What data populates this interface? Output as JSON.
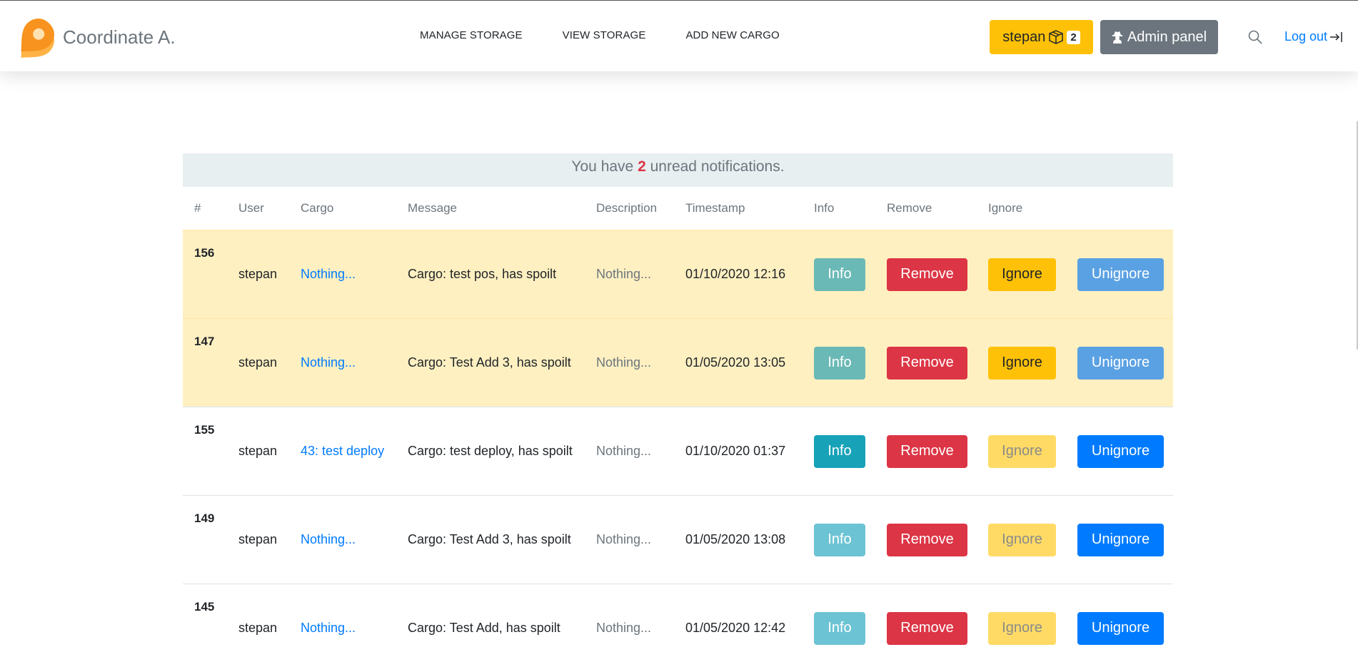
{
  "brand": {
    "name": "Coordinate A.",
    "logo": "map-pin-logo"
  },
  "nav": {
    "links": [
      "MANAGE STORAGE",
      "VIEW STORAGE",
      "ADD NEW CARGO"
    ],
    "user_button": {
      "label": "stepan",
      "icon": "box-icon",
      "badge": "2"
    },
    "admin_button": {
      "label": "Admin panel",
      "icon": "user-secret-icon"
    },
    "search_icon": "search-icon",
    "logout": {
      "label": "Log out",
      "icon": "sign-out-icon"
    }
  },
  "notifications": {
    "prefix": "You have ",
    "count": "2",
    "suffix": " unread notifications.",
    "columns": [
      "#",
      "User",
      "Cargo",
      "Message",
      "Description",
      "Timestamp",
      "Info",
      "Remove",
      "Ignore",
      ""
    ],
    "buttons": {
      "info": "Info",
      "remove": "Remove",
      "ignore": "Ignore",
      "unignore": "Unignore"
    },
    "rows": [
      {
        "id": "156",
        "user": "stepan",
        "cargo": "Nothing...",
        "message": "Cargo: test pos, has spoilt",
        "description": "Nothing...",
        "timestamp": "01/10/2020 12:16",
        "unread": true
      },
      {
        "id": "147",
        "user": "stepan",
        "cargo": "Nothing...",
        "message": "Cargo: Test Add 3, has spoilt",
        "description": "Nothing...",
        "timestamp": "01/05/2020 13:05",
        "unread": true
      },
      {
        "id": "155",
        "user": "stepan",
        "cargo": "43: test deploy",
        "message": "Cargo: test deploy, has spoilt",
        "description": "Nothing...",
        "timestamp": "01/10/2020 01:37",
        "unread": false
      },
      {
        "id": "149",
        "user": "stepan",
        "cargo": "Nothing...",
        "message": "Cargo: Test Add 3, has spoilt",
        "description": "Nothing...",
        "timestamp": "01/05/2020 13:08",
        "unread": false
      },
      {
        "id": "145",
        "user": "stepan",
        "cargo": "Nothing...",
        "message": "Cargo: Test Add, has spoilt",
        "description": "Nothing...",
        "timestamp": "01/05/2020 12:42",
        "unread": false
      }
    ]
  },
  "colors": {
    "warning": "#ffc107",
    "danger": "#dc3545",
    "info": "#17a2b8",
    "primary": "#007bff",
    "secondary": "#6c757d",
    "unread_row": "#fff0c1"
  }
}
